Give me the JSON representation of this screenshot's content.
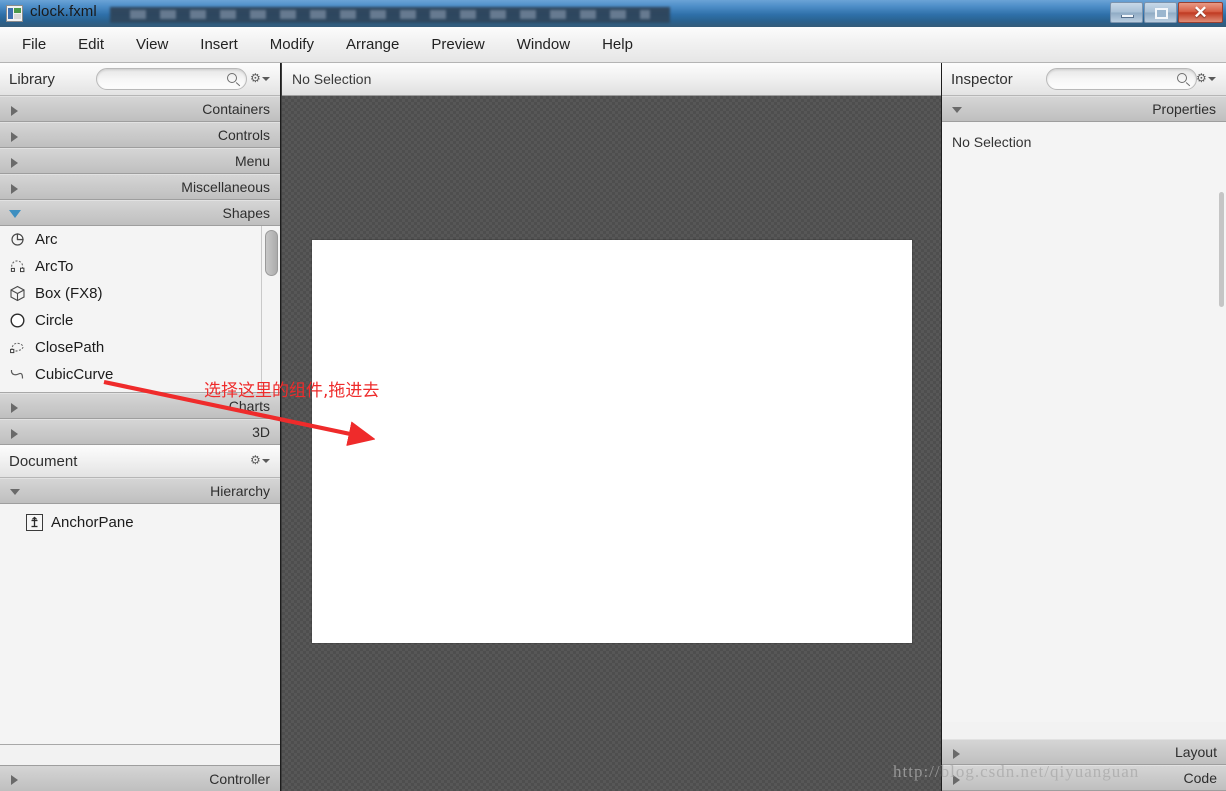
{
  "window": {
    "title": "clock.fxml",
    "icon": "scenebuilder-icon",
    "buttons": {
      "minimize": "minimize-button",
      "maximize": "maximize-button",
      "close": "✕"
    }
  },
  "menubar": {
    "items": [
      "File",
      "Edit",
      "View",
      "Insert",
      "Modify",
      "Arrange",
      "Preview",
      "Window",
      "Help"
    ]
  },
  "library": {
    "title": "Library",
    "search_value": "",
    "search_placeholder": "",
    "sections_top": [
      {
        "label": "Containers",
        "expanded": false
      },
      {
        "label": "Controls",
        "expanded": false
      },
      {
        "label": "Menu",
        "expanded": false
      },
      {
        "label": "Miscellaneous",
        "expanded": false
      },
      {
        "label": "Shapes",
        "expanded": true
      }
    ],
    "shapes": [
      {
        "label": "Arc",
        "icon": "arc-icon"
      },
      {
        "label": "ArcTo",
        "icon": "arcto-icon"
      },
      {
        "label": "Box  (FX8)",
        "icon": "box-icon"
      },
      {
        "label": "Circle",
        "icon": "circle-icon"
      },
      {
        "label": "ClosePath",
        "icon": "closepath-icon"
      },
      {
        "label": "CubicCurve",
        "icon": "cubiccurve-icon"
      }
    ],
    "sections_bottom": [
      {
        "label": "Charts",
        "expanded": false
      },
      {
        "label": "3D",
        "expanded": false
      }
    ]
  },
  "document": {
    "title": "Document",
    "hierarchy_label": "Hierarchy",
    "tree": [
      {
        "label": "AnchorPane",
        "icon": "anchorpane-icon"
      }
    ],
    "controller_label": "Controller"
  },
  "canvas": {
    "status": "No Selection"
  },
  "inspector": {
    "title": "Inspector",
    "search_value": "",
    "properties_label": "Properties",
    "no_selection": "No Selection",
    "layout_label": "Layout",
    "code_label": "Code"
  },
  "annotation": {
    "text": "选择这里的组件,拖进去",
    "color": "#ee2b2b",
    "arrow": "red-arrow"
  },
  "watermark": {
    "text": "http://blog.csdn.net/qiyuanguan"
  },
  "colors": {
    "titlebar_blue": "#2e6fa8",
    "close_red": "#c03a22",
    "canvas_gray": "#4e4e4e",
    "panel_bg": "#f2f2f2",
    "section_gray": "#cacaca",
    "annotation_red": "#ee2b2b"
  }
}
